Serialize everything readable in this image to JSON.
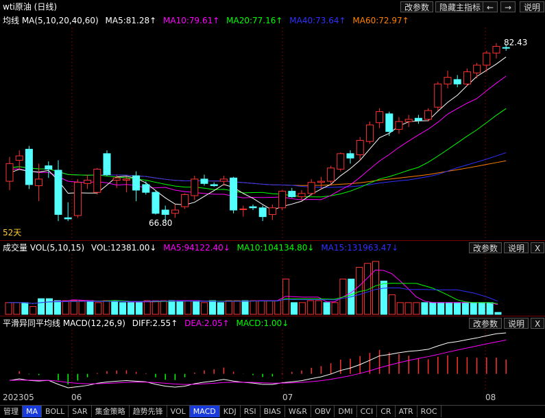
{
  "title_bar": {
    "title": "wti原油 (日线)",
    "buttons": [
      "改参数",
      "隐藏主指标",
      "←",
      "→",
      "说明"
    ]
  },
  "main": {
    "ma_header": {
      "label": "均线 MA(5,10,20,40,60)",
      "ma5": "MA5:81.28↑",
      "ma10": "MA10:79.61↑",
      "ma20": "MA20:77.16↑",
      "ma40": "MA40:73.64↑",
      "ma60": "MA60:72.97↑"
    },
    "last_price": "82.43",
    "low_label": "66.80",
    "days_label": "52天"
  },
  "vol": {
    "label": "成交量 VOL(5,10,15)",
    "vol": "VOL:12381.00↓",
    "ma5": "MA5:94122.40↓",
    "ma10": "MA10:104134.80↓",
    "ma15": "MA15:131963.47↓",
    "buttons": [
      "改参数",
      "说明",
      "X"
    ]
  },
  "macd": {
    "label": "平滑异同平均线 MACD(12,26,9)",
    "diff": "DIFF:2.55↑",
    "dea": "DEA:2.05↑",
    "macd": "MACD:1.00↓",
    "buttons": [
      "改参数",
      "说明",
      "X"
    ]
  },
  "x_axis": [
    "202305",
    "06",
    "07",
    "08"
  ],
  "tabs": [
    "管理",
    "MA",
    "BOLL",
    "SAR",
    "集金策略",
    "趋势先锋",
    "VOL",
    "MACD",
    "KDJ",
    "RSI",
    "BIAS",
    "W&R",
    "OBV",
    "DMI",
    "CCI",
    "CR",
    "ATR",
    "ROC"
  ],
  "active_tabs": [
    "MA",
    "MACD"
  ],
  "colors": {
    "up": "#ff3232",
    "down": "#54ffff",
    "ma5": "#ffffff",
    "ma10": "#ff00ff",
    "ma20": "#00ff00",
    "ma40": "#3030ff",
    "ma60": "#ff8000",
    "grid": "#7a0000"
  },
  "chart_data": {
    "type": "candlestick",
    "candles": [
      {
        "o": 70.4,
        "h": 72.6,
        "l": 69.6,
        "c": 72.0
      },
      {
        "o": 72.3,
        "h": 73.2,
        "l": 71.4,
        "c": 72.7
      },
      {
        "o": 73.3,
        "h": 73.6,
        "l": 69.7,
        "c": 70.1
      },
      {
        "o": 70.0,
        "h": 72.0,
        "l": 68.6,
        "c": 70.6
      },
      {
        "o": 71.8,
        "h": 72.2,
        "l": 70.7,
        "c": 71.5
      },
      {
        "o": 71.4,
        "h": 72.3,
        "l": 66.8,
        "c": 67.4
      },
      {
        "o": 67.1,
        "h": 68.5,
        "l": 66.8,
        "c": 67.0
      },
      {
        "o": 67.3,
        "h": 70.6,
        "l": 67.1,
        "c": 70.3
      },
      {
        "o": 70.2,
        "h": 71.0,
        "l": 69.7,
        "c": 70.5
      },
      {
        "o": 69.4,
        "h": 71.6,
        "l": 69.2,
        "c": 71.5
      },
      {
        "o": 72.9,
        "h": 73.2,
        "l": 70.9,
        "c": 71.0
      },
      {
        "o": 70.5,
        "h": 71.0,
        "l": 69.8,
        "c": 70.7
      },
      {
        "o": 70.5,
        "h": 70.8,
        "l": 69.4,
        "c": 70.6
      },
      {
        "o": 70.9,
        "h": 71.3,
        "l": 68.6,
        "c": 69.6
      },
      {
        "o": 70.1,
        "h": 70.4,
        "l": 69.2,
        "c": 69.4
      },
      {
        "o": 69.4,
        "h": 69.6,
        "l": 67.4,
        "c": 67.5
      },
      {
        "o": 67.8,
        "h": 68.2,
        "l": 66.8,
        "c": 67.4
      },
      {
        "o": 67.5,
        "h": 68.3,
        "l": 67.1,
        "c": 67.8
      },
      {
        "o": 68.1,
        "h": 69.3,
        "l": 67.9,
        "c": 69.2
      },
      {
        "o": 69.1,
        "h": 70.9,
        "l": 68.7,
        "c": 70.6
      },
      {
        "o": 70.6,
        "h": 71.0,
        "l": 70.0,
        "c": 70.2
      },
      {
        "o": 70.1,
        "h": 70.3,
        "l": 69.9,
        "c": 70.0
      },
      {
        "o": 70.4,
        "h": 70.9,
        "l": 70.0,
        "c": 70.6
      },
      {
        "o": 70.7,
        "h": 70.8,
        "l": 67.5,
        "c": 67.8
      },
      {
        "o": 67.9,
        "h": 68.2,
        "l": 67.2,
        "c": 67.9
      },
      {
        "o": 68.1,
        "h": 68.3,
        "l": 67.8,
        "c": 68.0
      },
      {
        "o": 68.0,
        "h": 68.2,
        "l": 66.8,
        "c": 67.2
      },
      {
        "o": 67.4,
        "h": 68.3,
        "l": 66.9,
        "c": 68.0
      },
      {
        "o": 68.0,
        "h": 69.6,
        "l": 67.8,
        "c": 69.5
      },
      {
        "o": 69.5,
        "h": 69.8,
        "l": 68.9,
        "c": 69.0
      },
      {
        "o": 69.0,
        "h": 69.6,
        "l": 68.7,
        "c": 69.3
      },
      {
        "o": 69.3,
        "h": 70.6,
        "l": 69.1,
        "c": 70.3
      },
      {
        "o": 70.3,
        "h": 70.8,
        "l": 69.7,
        "c": 70.4
      },
      {
        "o": 70.4,
        "h": 71.8,
        "l": 70.1,
        "c": 71.6
      },
      {
        "o": 71.5,
        "h": 73.0,
        "l": 71.3,
        "c": 72.9
      },
      {
        "o": 72.9,
        "h": 73.2,
        "l": 72.0,
        "c": 72.5
      },
      {
        "o": 72.8,
        "h": 74.4,
        "l": 72.3,
        "c": 74.1
      },
      {
        "o": 74.0,
        "h": 75.8,
        "l": 73.8,
        "c": 75.5
      },
      {
        "o": 75.7,
        "h": 77.0,
        "l": 75.2,
        "c": 76.7
      },
      {
        "o": 76.5,
        "h": 76.7,
        "l": 74.5,
        "c": 74.9
      },
      {
        "o": 75.1,
        "h": 76.2,
        "l": 74.7,
        "c": 75.8
      },
      {
        "o": 75.8,
        "h": 76.4,
        "l": 75.3,
        "c": 76.0
      },
      {
        "o": 76.1,
        "h": 76.4,
        "l": 75.6,
        "c": 75.9
      },
      {
        "o": 76.0,
        "h": 77.0,
        "l": 75.8,
        "c": 76.8
      },
      {
        "o": 77.1,
        "h": 79.4,
        "l": 76.8,
        "c": 79.2
      },
      {
        "o": 79.2,
        "h": 80.4,
        "l": 78.8,
        "c": 79.8
      },
      {
        "o": 79.6,
        "h": 80.0,
        "l": 78.9,
        "c": 79.2
      },
      {
        "o": 79.2,
        "h": 80.6,
        "l": 79.0,
        "c": 80.3
      },
      {
        "o": 80.2,
        "h": 81.1,
        "l": 79.7,
        "c": 80.9
      },
      {
        "o": 80.9,
        "h": 82.2,
        "l": 80.3,
        "c": 82.0
      },
      {
        "o": 82.0,
        "h": 82.9,
        "l": 81.5,
        "c": 82.6
      },
      {
        "o": 82.5,
        "h": 82.8,
        "l": 82.2,
        "c": 82.43
      }
    ],
    "volume": [
      6,
      6,
      6,
      4,
      8,
      8,
      7,
      7,
      7,
      7,
      7,
      6,
      7,
      7,
      6,
      6,
      6,
      7,
      7,
      7,
      7,
      7,
      7,
      7,
      6,
      7,
      6,
      7,
      7,
      7,
      7,
      7,
      7,
      7,
      18,
      6,
      6,
      7,
      7,
      6,
      6,
      18,
      18,
      24,
      26,
      27,
      17,
      10,
      6,
      6,
      6,
      6,
      6,
      6,
      6,
      6,
      6,
      6,
      6,
      6,
      1
    ],
    "ylim": [
      66,
      84
    ]
  }
}
